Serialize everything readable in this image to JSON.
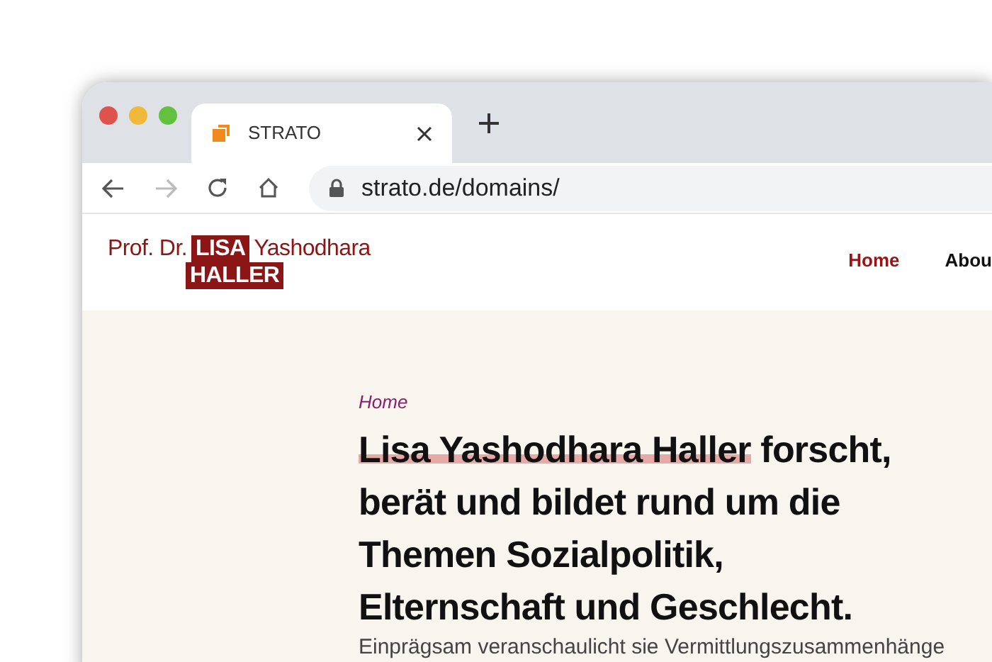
{
  "browser": {
    "tab": {
      "title": "STRATO",
      "selected": true
    },
    "url": "strato.de/domains/"
  },
  "logo": {
    "prefix": "Prof. Dr.",
    "first": "LISA",
    "middle": "Yashodhara",
    "last": "HALLER"
  },
  "nav": [
    {
      "label": "Home",
      "selected": true
    },
    {
      "label": "Abou",
      "selected": false
    }
  ],
  "hero": {
    "breadcrumb": "Home",
    "headline": [
      {
        "marked": "Lisa Yashodhara Haller",
        "text": " forscht,"
      },
      {
        "text": "berät und bildet rund um die"
      },
      {
        "text": "Themen Sozialpolitik,"
      },
      {
        "text": "Elternschaft und Geschlecht."
      }
    ],
    "intro": "Einprägsam veranschaulicht sie Vermittlungszusammenhänge"
  }
}
